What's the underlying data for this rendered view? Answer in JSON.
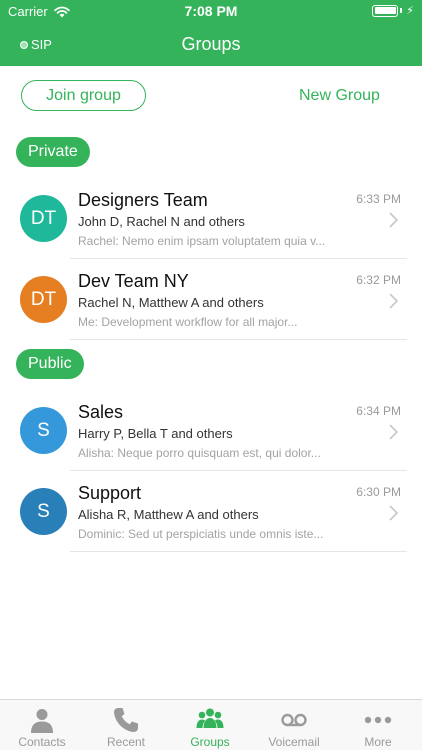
{
  "status_bar": {
    "carrier": "Carrier",
    "time": "7:08 PM",
    "battery_level": 1.0
  },
  "header": {
    "sip_label": "SIP",
    "title": "Groups"
  },
  "actions": {
    "join_label": "Join group",
    "new_group_label": "New Group"
  },
  "sections": {
    "private_label": "Private",
    "public_label": "Public"
  },
  "groups": [
    {
      "initials": "DT",
      "name": "Designers Team",
      "members": "John D, Rachel N and others",
      "preview": "Rachel: Nemo enim ipsam voluptatem quia v...",
      "time": "6:33 PM",
      "color": "#1fb89a"
    },
    {
      "initials": "DT",
      "name": "Dev Team NY",
      "members": "Rachel N, Matthew A and others",
      "preview": "Me: Development workflow for all major...",
      "time": "6:32 PM",
      "color": "#e67e22"
    },
    {
      "initials": "S",
      "name": "Sales",
      "members": "Harry P, Bella T and others",
      "preview": "Alisha: Neque porro quisquam est, qui dolor...",
      "time": "6:34 PM",
      "color": "#3498db"
    },
    {
      "initials": "S",
      "name": "Support",
      "members": "Alisha R, Matthew A and others",
      "preview": "Dominic: Sed ut perspiciatis unde omnis iste...",
      "time": "6:30 PM",
      "color": "#2980b9"
    }
  ],
  "tabs": [
    {
      "label": "Contacts",
      "icon": "person-icon"
    },
    {
      "label": "Recent",
      "icon": "phone-icon"
    },
    {
      "label": "Groups",
      "icon": "group-icon",
      "active": true
    },
    {
      "label": "Voicemail",
      "icon": "voicemail-icon"
    },
    {
      "label": "More",
      "icon": "more-icon"
    }
  ],
  "colors": {
    "accent": "#34b35a",
    "inactive": "#9a9a9a"
  }
}
